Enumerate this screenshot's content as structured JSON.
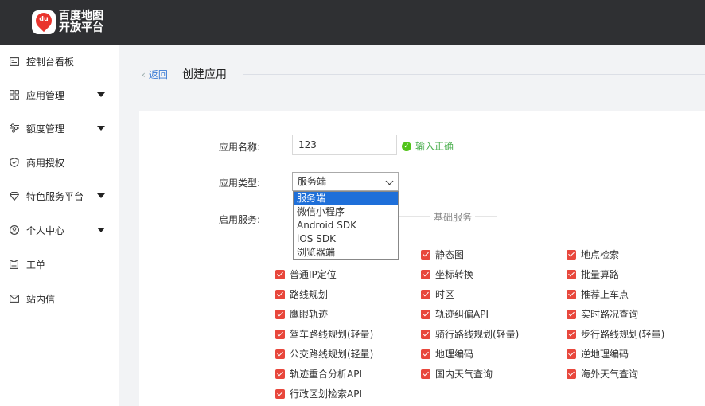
{
  "brand": {
    "logo_badge": "du",
    "logo_line1": "百度地图",
    "logo_line2": "开放平台",
    "accent": "#e9342d"
  },
  "sidebar": {
    "items": [
      {
        "label": "控制台看板",
        "icon": "dashboard-icon",
        "has_caret": false
      },
      {
        "label": "应用管理",
        "icon": "grid-icon",
        "has_caret": true
      },
      {
        "label": "额度管理",
        "icon": "sliders-icon",
        "has_caret": true
      },
      {
        "label": "商用授权",
        "icon": "shield-icon",
        "has_caret": false
      },
      {
        "label": "特色服务平台",
        "icon": "diamond-icon",
        "has_caret": true
      },
      {
        "label": "个人中心",
        "icon": "user-icon",
        "has_caret": true
      },
      {
        "label": "工单",
        "icon": "clipboard-icon",
        "has_caret": false
      },
      {
        "label": "站内信",
        "icon": "mail-icon",
        "has_caret": false
      }
    ]
  },
  "header": {
    "back_label": "返回",
    "back_icon": "chevron-left-icon",
    "title": "创建应用"
  },
  "form": {
    "name_label": "应用名称:",
    "name_value": "123",
    "name_valid_text": "输入正确",
    "type_label": "应用类型:",
    "type_selected": "服务端",
    "type_options": [
      "服务端",
      "微信小程序",
      "Android SDK",
      "iOS SDK",
      "浏览器端"
    ],
    "services_label": "启用服务:",
    "section_title": "基础服务"
  },
  "services": {
    "checked_color": "#e8473c",
    "col2_row0": "静态图",
    "col3_row0": "地点检索",
    "rows": [
      [
        "普通IP定位",
        "坐标转换",
        "批量算路"
      ],
      [
        "路线规划",
        "时区",
        "推荐上车点"
      ],
      [
        "鹰眼轨迹",
        "轨迹纠偏API",
        "实时路况查询"
      ],
      [
        "驾车路线规划(轻量)",
        "骑行路线规划(轻量)",
        "步行路线规划(轻量)"
      ],
      [
        "公交路线规划(轻量)",
        "地理编码",
        "逆地理编码"
      ],
      [
        "轨迹重合分析API",
        "国内天气查询",
        "海外天气查询"
      ],
      [
        "行政区划检索API"
      ]
    ]
  }
}
